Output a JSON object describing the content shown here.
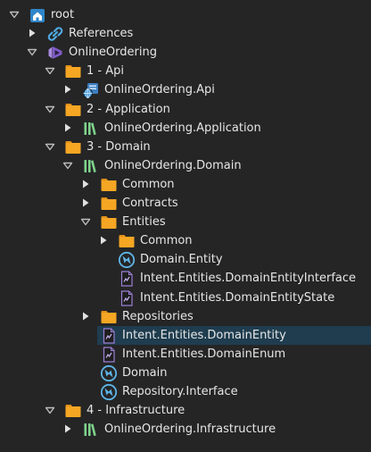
{
  "colors": {
    "background": "#252526",
    "text": "#e6e6e6",
    "selection": "#1f3d4f",
    "folder": "#f5a623",
    "solution": "#a98bdf",
    "project": "#7fd38c",
    "domain_icon": "#5fb5e8",
    "caret": "#bdbdbd"
  },
  "tree": {
    "items": [
      {
        "label": "root",
        "icon": "home-icon",
        "caret": "expanded",
        "depth": 0
      },
      {
        "label": "References",
        "icon": "references-link-icon",
        "caret": "collapsed",
        "depth": 1
      },
      {
        "label": "OnlineOrdering",
        "icon": "solution-icon",
        "caret": "expanded",
        "depth": 1
      },
      {
        "label": "1 - Api",
        "icon": "folder-icon",
        "caret": "expanded",
        "depth": 2
      },
      {
        "label": "OnlineOrdering.Api",
        "icon": "api-project-icon",
        "caret": "collapsed",
        "depth": 3
      },
      {
        "label": "2 - Application",
        "icon": "folder-icon",
        "caret": "expanded",
        "depth": 2
      },
      {
        "label": "OnlineOrdering.Application",
        "icon": "project-library-icon",
        "caret": "collapsed",
        "depth": 3
      },
      {
        "label": "3 - Domain",
        "icon": "folder-icon",
        "caret": "expanded",
        "depth": 2
      },
      {
        "label": "OnlineOrdering.Domain",
        "icon": "project-library-icon",
        "caret": "expanded",
        "depth": 3
      },
      {
        "label": "Common",
        "icon": "folder-icon",
        "caret": "collapsed",
        "depth": 4
      },
      {
        "label": "Contracts",
        "icon": "folder-icon",
        "caret": "collapsed",
        "depth": 4
      },
      {
        "label": "Entities",
        "icon": "folder-icon",
        "caret": "expanded",
        "depth": 4
      },
      {
        "label": "Common",
        "icon": "folder-icon",
        "caret": "collapsed",
        "depth": 5
      },
      {
        "label": "Domain.Entity",
        "icon": "domain-package-icon",
        "caret": "none",
        "depth": 5
      },
      {
        "label": "Intent.Entities.DomainEntityInterface",
        "icon": "template-file-icon",
        "caret": "none",
        "depth": 5
      },
      {
        "label": "Intent.Entities.DomainEntityState",
        "icon": "template-file-icon",
        "caret": "none",
        "depth": 5
      },
      {
        "label": "Repositories",
        "icon": "folder-icon",
        "caret": "collapsed",
        "depth": 4
      },
      {
        "label": "Intent.Entities.DomainEntity",
        "icon": "template-file-icon",
        "caret": "none",
        "depth": 4,
        "selected": true
      },
      {
        "label": "Intent.Entities.DomainEnum",
        "icon": "template-file-icon",
        "caret": "none",
        "depth": 4
      },
      {
        "label": "Domain",
        "icon": "domain-package-icon",
        "caret": "none",
        "depth": 4
      },
      {
        "label": "Repository.Interface",
        "icon": "domain-package-icon",
        "caret": "none",
        "depth": 4
      },
      {
        "label": "4 - Infrastructure",
        "icon": "folder-icon",
        "caret": "expanded",
        "depth": 2
      },
      {
        "label": "OnlineOrdering.Infrastructure",
        "icon": "project-library-icon",
        "caret": "collapsed",
        "depth": 3
      }
    ]
  }
}
